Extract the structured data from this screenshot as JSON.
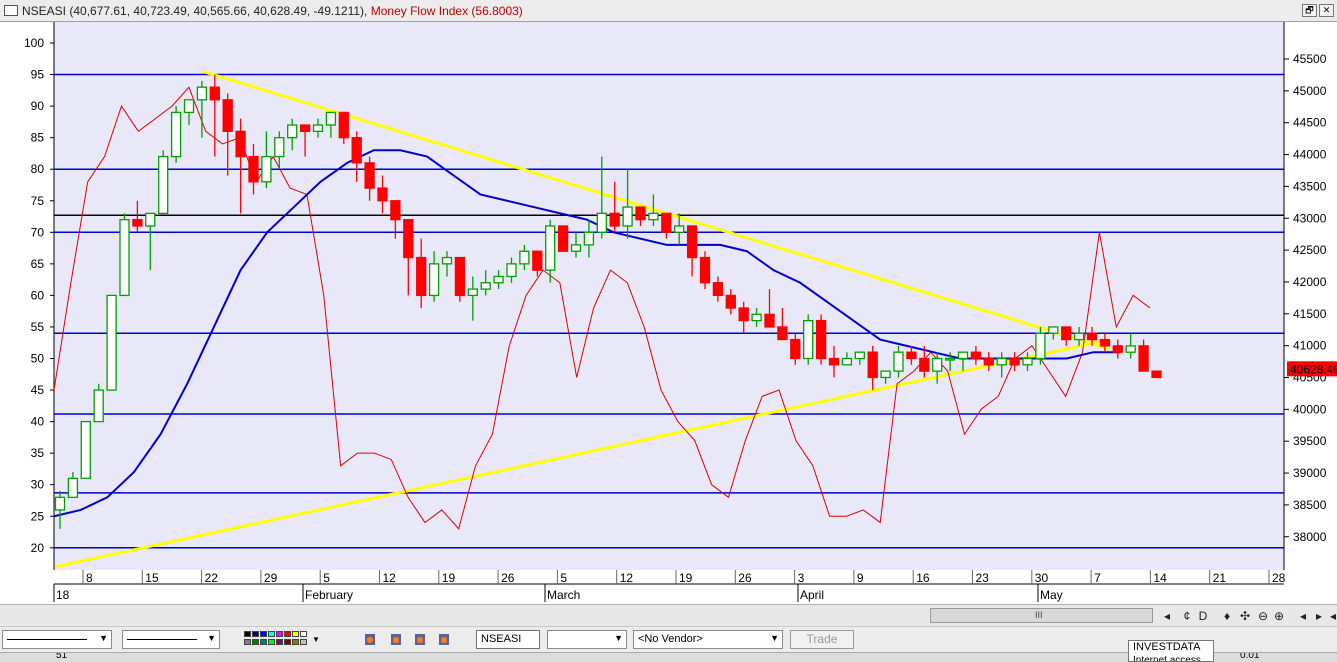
{
  "window": {
    "title_prefix": "NSEASI (40,677.61, 40,723.49, 40,565.66, 40,628.49, -49.1211),",
    "title_indicator": "Money Flow Index (56.8003)",
    "restore_glyph": "🗗",
    "close_glyph": "✕"
  },
  "chart": {
    "left_axis_ticks": [
      100,
      95,
      90,
      85,
      80,
      75,
      70,
      65,
      60,
      55,
      50,
      45,
      40,
      35,
      30,
      25,
      20
    ],
    "right_axis_ticks": [
      45500,
      45000,
      44500,
      44000,
      43500,
      43000,
      42500,
      42000,
      41500,
      41000,
      40500,
      40000,
      39500,
      39000,
      38500,
      38000
    ],
    "date_ticks": [
      "8",
      "15",
      "22",
      "29",
      "5",
      "12",
      "19",
      "26",
      "5",
      "12",
      "19",
      "26",
      "3",
      "9",
      "16",
      "23",
      "30",
      "7",
      "14",
      "21",
      "28"
    ],
    "month_labels": [
      "18",
      "February",
      "March",
      "April",
      "May"
    ],
    "last_price_label": "40628.49",
    "colors": {
      "up": "#00a000",
      "down": "#ff0000",
      "ma": "#0000cc",
      "mfi": "#dd0000",
      "trend": "#ffff00",
      "grid": "#0000cc",
      "bg": "#e8e8f8"
    }
  },
  "chart_data": {
    "type": "candlestick",
    "candles": [
      [
        26,
        29,
        23,
        28
      ],
      [
        28,
        32,
        28,
        31
      ],
      [
        31,
        40,
        31,
        40
      ],
      [
        40,
        46,
        40,
        45
      ],
      [
        45,
        60,
        45,
        60
      ],
      [
        60,
        73,
        60,
        72
      ],
      [
        72,
        75,
        70,
        71
      ],
      [
        71,
        73,
        64,
        73
      ],
      [
        73,
        83,
        73,
        82
      ],
      [
        82,
        90,
        81,
        89
      ],
      [
        89,
        91,
        87,
        91
      ],
      [
        91,
        94,
        85,
        93
      ],
      [
        93,
        95,
        82,
        91
      ],
      [
        91,
        92,
        79,
        86
      ],
      [
        86,
        88,
        73,
        82
      ],
      [
        82,
        84,
        76,
        78
      ],
      [
        78,
        86,
        77,
        82
      ],
      [
        82,
        86,
        80,
        85
      ],
      [
        85,
        88,
        83,
        87
      ],
      [
        87,
        87,
        82,
        86
      ],
      [
        86,
        88,
        85,
        87
      ],
      [
        87,
        89,
        85,
        89
      ],
      [
        89,
        88,
        84,
        85
      ],
      [
        85,
        86,
        78,
        81
      ],
      [
        81,
        82,
        75,
        77
      ],
      [
        77,
        79,
        73,
        75
      ],
      [
        75,
        75,
        69,
        72
      ],
      [
        72,
        72,
        60,
        66
      ],
      [
        66,
        69,
        58,
        60
      ],
      [
        60,
        67,
        59,
        65
      ],
      [
        65,
        67,
        63,
        66
      ],
      [
        66,
        66,
        59,
        60
      ],
      [
        60,
        63,
        56,
        61
      ],
      [
        61,
        64,
        60,
        62
      ],
      [
        62,
        64,
        61,
        63
      ],
      [
        63,
        66,
        62,
        65
      ],
      [
        65,
        68,
        64,
        67
      ],
      [
        67,
        67,
        63,
        64
      ],
      [
        64,
        72,
        62,
        71
      ],
      [
        71,
        70,
        67,
        67
      ],
      [
        67,
        70,
        66,
        68
      ],
      [
        68,
        72,
        66,
        70
      ],
      [
        70,
        82,
        69,
        73
      ],
      [
        73,
        78,
        70,
        71
      ],
      [
        71,
        80,
        69,
        74
      ],
      [
        74,
        73,
        71,
        72
      ],
      [
        72,
        76,
        71,
        73
      ],
      [
        73,
        72,
        69,
        70
      ],
      [
        70,
        73,
        68,
        71
      ],
      [
        71,
        70,
        63,
        66
      ],
      [
        66,
        67,
        61,
        62
      ],
      [
        62,
        63,
        59,
        60
      ],
      [
        60,
        61,
        57,
        58
      ],
      [
        58,
        59,
        54,
        56
      ],
      [
        56,
        58,
        55,
        57
      ],
      [
        57,
        61,
        55,
        55
      ],
      [
        55,
        58,
        54,
        53
      ],
      [
        53,
        54,
        49,
        50
      ],
      [
        50,
        57,
        49,
        56
      ],
      [
        56,
        57,
        49,
        50
      ],
      [
        50,
        52,
        47,
        49
      ],
      [
        49,
        51,
        49,
        50
      ],
      [
        50,
        51,
        49,
        51
      ],
      [
        51,
        52,
        45,
        47
      ],
      [
        47,
        48,
        46,
        48
      ],
      [
        48,
        52,
        47,
        51
      ],
      [
        51,
        52,
        49,
        50
      ],
      [
        50,
        52,
        47,
        48
      ],
      [
        48,
        51,
        46,
        50
      ],
      [
        50,
        51,
        48,
        50
      ],
      [
        50,
        51,
        48,
        51
      ],
      [
        51,
        52,
        49,
        50
      ],
      [
        50,
        51,
        48,
        49
      ],
      [
        49,
        51,
        47,
        50
      ],
      [
        50,
        51,
        48,
        49
      ],
      [
        49,
        51,
        48,
        50
      ],
      [
        50,
        55,
        49,
        54
      ],
      [
        54,
        55,
        53,
        55
      ],
      [
        55,
        55,
        52,
        53
      ],
      [
        53,
        55,
        52,
        54
      ],
      [
        54,
        55,
        52,
        53
      ],
      [
        53,
        54,
        51,
        52
      ],
      [
        52,
        53,
        50,
        51
      ],
      [
        51,
        54,
        50,
        52
      ],
      [
        52,
        53,
        50,
        48
      ],
      [
        48,
        48,
        47,
        47
      ]
    ]
  },
  "toolbar": {
    "symbol_value": "NSEASI",
    "vendor_value": "<No Vendor>",
    "trade_label": "Trade",
    "scroll_grip": "III",
    "nav_glyphs": [
      "◂",
      "¢",
      "D",
      "♦",
      "✣",
      "⊖",
      "⊕",
      "◂",
      "▸",
      "◂"
    ]
  },
  "status": {
    "popup_title": "INVESTDATA",
    "popup_sub": "Internet access",
    "left_fragment": "51",
    "right_fragment": "0.01"
  }
}
